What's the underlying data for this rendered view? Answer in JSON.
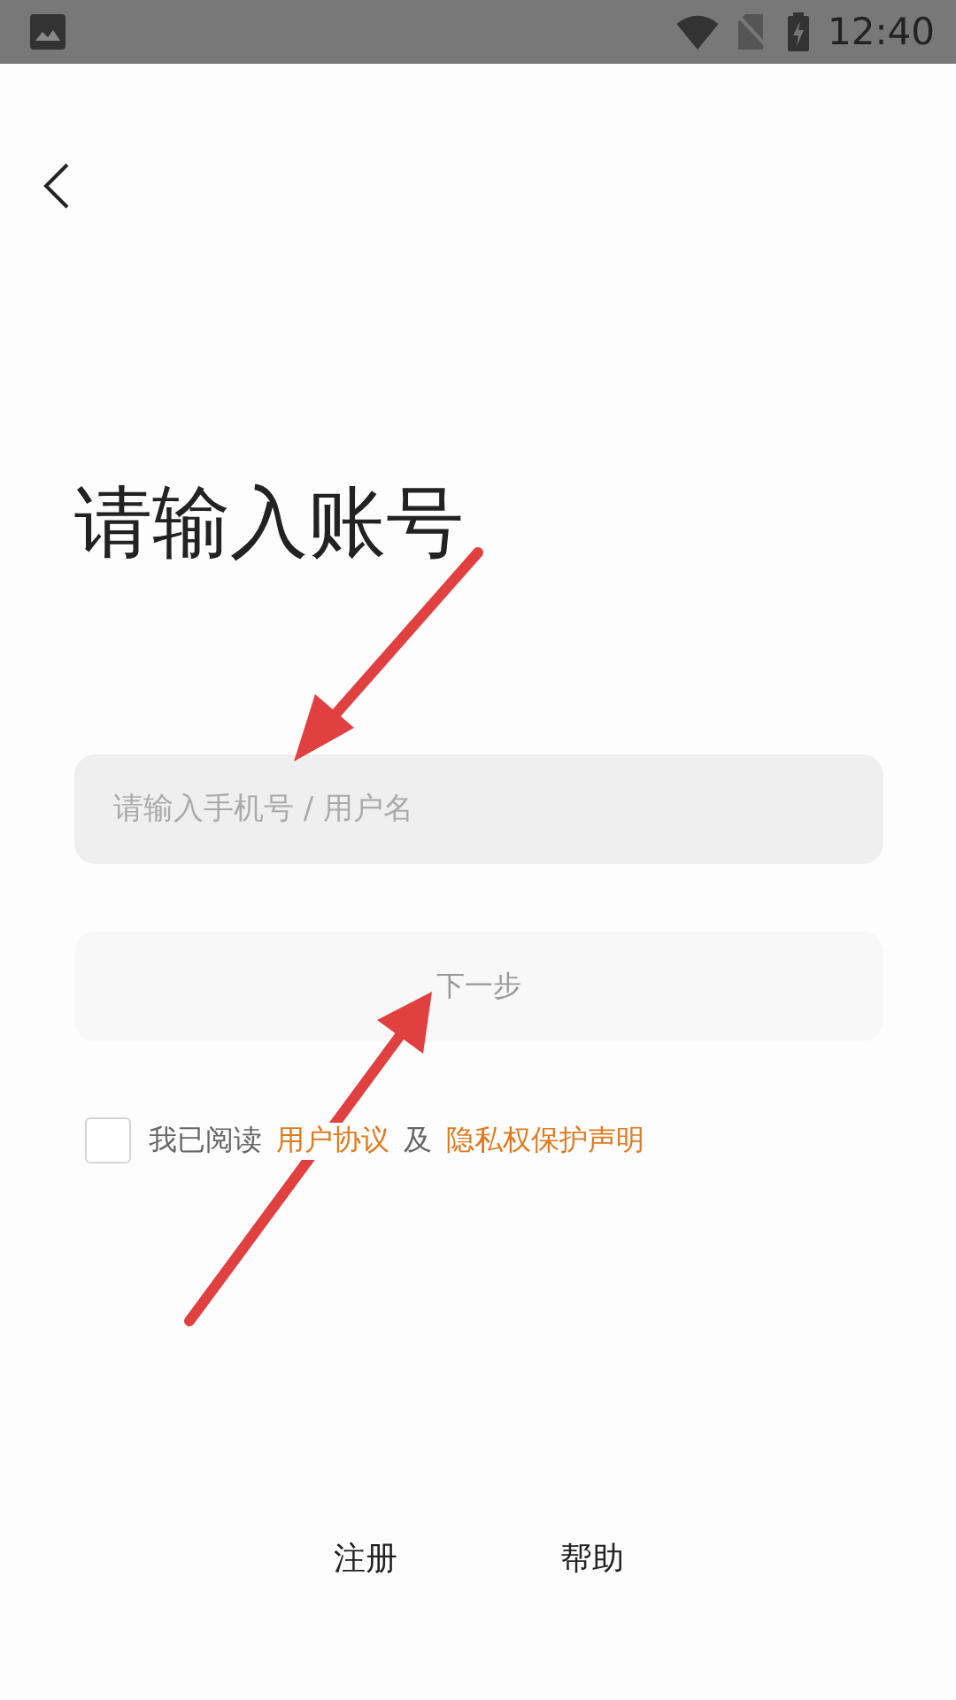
{
  "status_bar": {
    "time": "12:40"
  },
  "title": "请输入账号",
  "account_field": {
    "placeholder": "请输入手机号 / 用户名"
  },
  "next_button": {
    "label": "下一步",
    "disabled": true
  },
  "agreement": {
    "checked": false,
    "parts": [
      {
        "kind": "text",
        "text": "我已阅读"
      },
      {
        "kind": "link",
        "text": "用户协议"
      },
      {
        "kind": "text",
        "text": "及"
      },
      {
        "kind": "link",
        "text": "隐私权保护声明"
      }
    ]
  },
  "footer_links": [
    "注册",
    "帮助"
  ]
}
